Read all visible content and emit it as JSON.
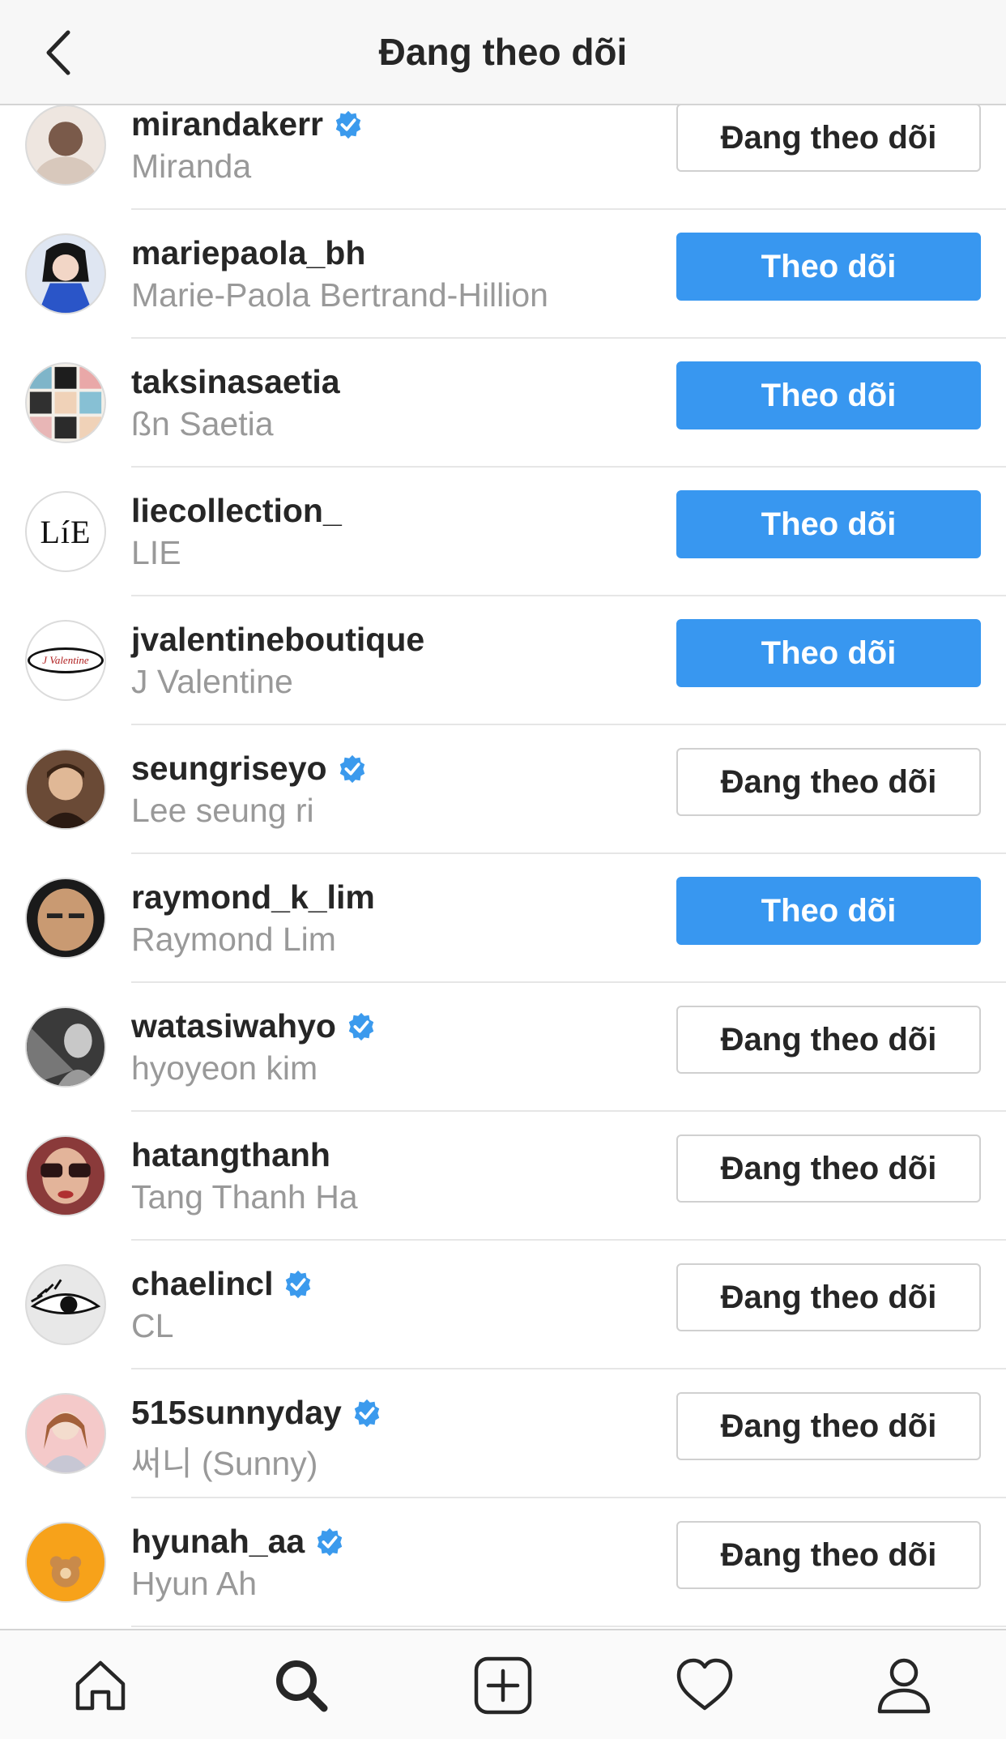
{
  "header": {
    "title": "Đang theo dõi"
  },
  "colors": {
    "follow_blue": "#3897f0",
    "verified_blue": "#3b9aed",
    "muted_text": "#999999"
  },
  "rows": [
    {
      "username": "mirandakerr",
      "fullname": "Miranda",
      "verified": true,
      "button": "Đang theo dõi",
      "following": true
    },
    {
      "username": "mariepaola_bh",
      "fullname": "Marie-Paola Bertrand-Hillion",
      "verified": false,
      "button": "Theo dõi",
      "following": false
    },
    {
      "username": "taksinasaetia",
      "fullname": "ßn Saetia",
      "verified": false,
      "button": "Theo dõi",
      "following": false
    },
    {
      "username": "liecollection_",
      "fullname": "LIE",
      "verified": false,
      "button": "Theo dõi",
      "following": false,
      "avatar_text": "LíE"
    },
    {
      "username": "jvalentineboutique",
      "fullname": "J Valentine",
      "verified": false,
      "button": "Theo dõi",
      "following": false,
      "avatar_text": "J Valentine"
    },
    {
      "username": "seungriseyo",
      "fullname": "Lee seung ri",
      "verified": true,
      "button": "Đang theo dõi",
      "following": true
    },
    {
      "username": "raymond_k_lim",
      "fullname": "Raymond Lim",
      "verified": false,
      "button": "Theo dõi",
      "following": false
    },
    {
      "username": "watasiwahyo",
      "fullname": "hyoyeon kim",
      "verified": true,
      "button": "Đang theo dõi",
      "following": true
    },
    {
      "username": "hatangthanh",
      "fullname": "Tang Thanh Ha",
      "verified": false,
      "button": "Đang theo dõi",
      "following": true
    },
    {
      "username": "chaelincl",
      "fullname": "CL",
      "verified": true,
      "button": "Đang theo dõi",
      "following": true
    },
    {
      "username": "515sunnyday",
      "fullname": "써니 (Sunny)",
      "verified": true,
      "button": "Đang theo dõi",
      "following": true
    },
    {
      "username": "hyunah_aa",
      "fullname": "Hyun Ah",
      "verified": true,
      "button": "Đang theo dõi",
      "following": true
    }
  ],
  "tabbar": {
    "items": [
      {
        "icon": "home-icon"
      },
      {
        "icon": "search-icon",
        "active": true
      },
      {
        "icon": "add-post-icon"
      },
      {
        "icon": "heart-icon"
      },
      {
        "icon": "profile-icon"
      }
    ]
  }
}
